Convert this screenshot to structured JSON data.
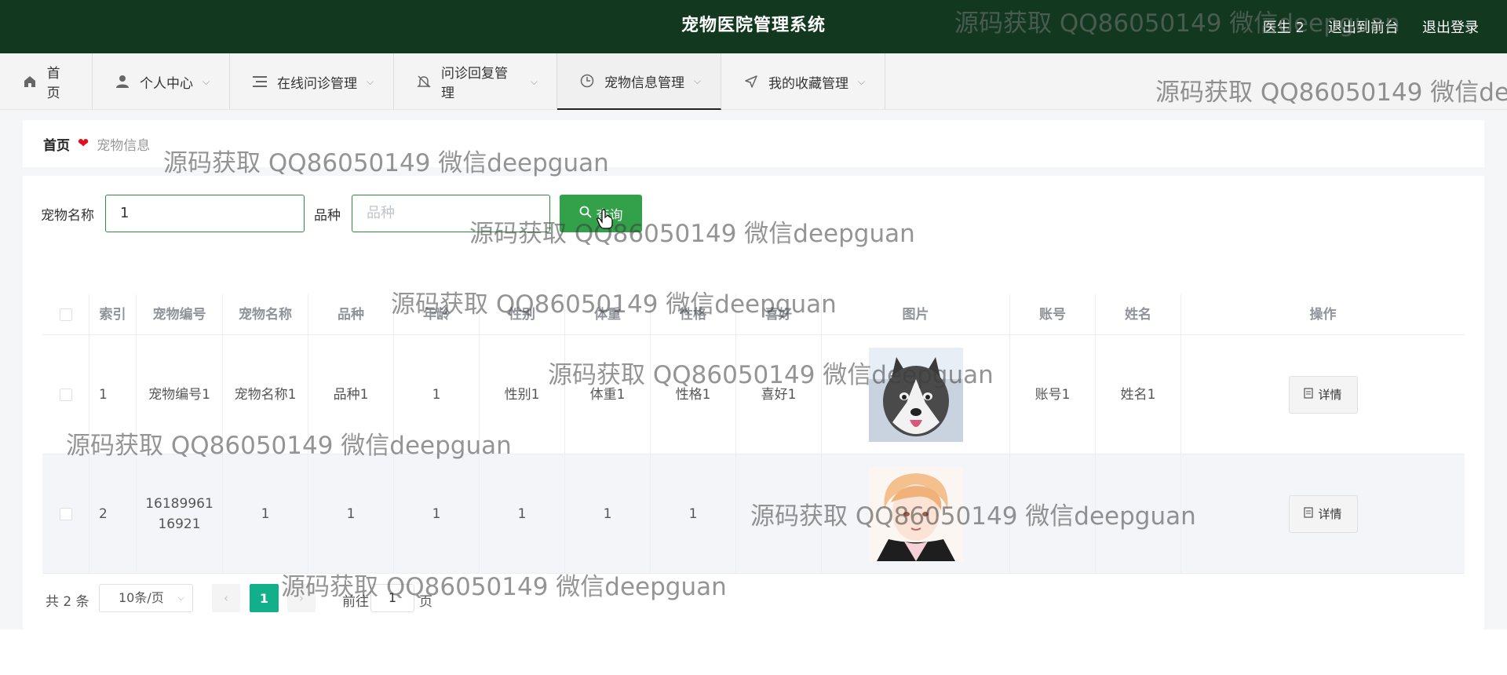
{
  "header": {
    "title": "宠物医院管理系统",
    "user": "医生 2",
    "to_front": "退出到前台",
    "logout": "退出登录"
  },
  "nav": [
    {
      "label": "首页",
      "icon": "home-icon"
    },
    {
      "label": "个人中心",
      "icon": "user-icon"
    },
    {
      "label": "在线问诊管理",
      "icon": "list-icon"
    },
    {
      "label": "问诊回复管理",
      "icon": "bell-icon"
    },
    {
      "label": "宠物信息管理",
      "icon": "clock-icon"
    },
    {
      "label": "我的收藏管理",
      "icon": "send-icon"
    }
  ],
  "breadcrumb": {
    "home": "首页",
    "current": "宠物信息"
  },
  "search": {
    "name_label": "宠物名称",
    "name_value": "1",
    "breed_label": "品种",
    "breed_placeholder": "品种",
    "button": "查询"
  },
  "table": {
    "headers": [
      "索引",
      "宠物编号",
      "宠物名称",
      "品种",
      "年龄",
      "性别",
      "体重",
      "性格",
      "喜好",
      "图片",
      "账号",
      "姓名",
      "操作"
    ],
    "rows": [
      {
        "index": "1",
        "code": "宠物编号1",
        "name": "宠物名称1",
        "breed": "品种1",
        "age": "1",
        "sex": "性别1",
        "weight": "体重1",
        "temper": "性格1",
        "hobby": "喜好1",
        "image": "husky-dog-photo",
        "account": "账号1",
        "real_name": "姓名1",
        "action": "详情"
      },
      {
        "index": "2",
        "code": "16189961\n16921",
        "name": "1",
        "breed": "1",
        "age": "1",
        "sex": "1",
        "weight": "1",
        "temper": "1",
        "hobby": "",
        "image": "anime-portrait-photo",
        "account": "",
        "real_name": "",
        "action": "详情"
      }
    ]
  },
  "pagination": {
    "total": "共 2 条",
    "page_size": "10条/页",
    "current_page": "1",
    "goto_prefix": "前往",
    "goto_value": "1",
    "goto_suffix": "页"
  },
  "watermark": "源码获取 QQ86050149 微信deepguan",
  "colors": {
    "header_bg": "#12381f",
    "search_button": "#33a04a",
    "active_page": "#12b08a",
    "heart": "#e0101f"
  }
}
